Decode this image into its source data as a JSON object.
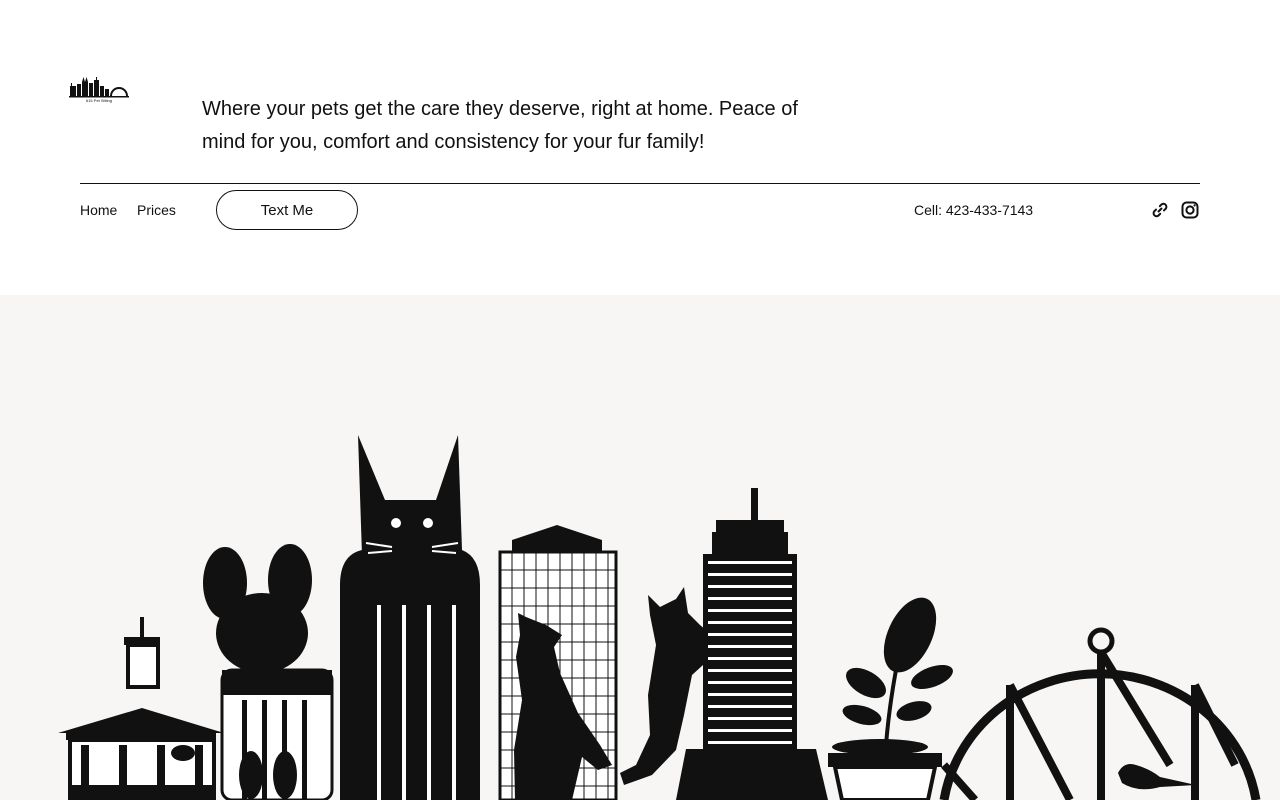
{
  "header": {
    "logo_text": "615 Pet Sitting",
    "tagline": "Where your pets get the care they deserve, right at home. Peace of mind for you, comfort and consistency for your fur family!"
  },
  "nav": {
    "home_label": "Home",
    "prices_label": "Prices",
    "text_button_label": "Text Me"
  },
  "contact": {
    "cell_text": "Cell: 423-433-7143"
  },
  "social": {
    "icons": [
      "link-icon",
      "instagram-icon"
    ]
  },
  "colors": {
    "text": "#111111",
    "page_background": "#ffffff",
    "hero_background": "#f8f6f4"
  }
}
